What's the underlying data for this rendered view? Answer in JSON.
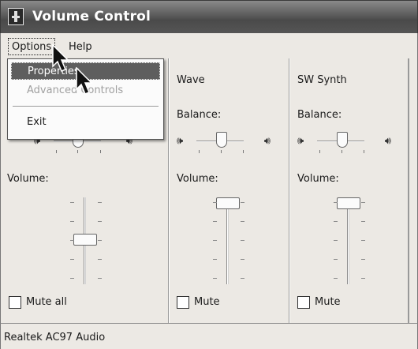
{
  "window": {
    "title": "Volume Control"
  },
  "menubar": {
    "options": "Options",
    "help": "Help"
  },
  "options_menu": {
    "properties": "Properties",
    "advanced_controls": "Advanced Controls",
    "exit": "Exit"
  },
  "columns": [
    {
      "title": "",
      "volume_label": "Volume:",
      "mute_label": "Mute all",
      "volume_level": 0.45,
      "muted": false
    },
    {
      "title": "Wave",
      "balance_label": "Balance:",
      "volume_label": "Volume:",
      "mute_label": "Mute",
      "volume_level": 0.95,
      "balance_level": 0.5,
      "muted": false
    },
    {
      "title": "SW Synth",
      "balance_label": "Balance:",
      "volume_label": "Volume:",
      "mute_label": "Mute",
      "volume_level": 0.95,
      "balance_level": 0.5,
      "muted": false
    }
  ],
  "master_balance_level": 0.5,
  "status": {
    "device": "Realtek AC97 Audio"
  },
  "icons": [
    "app-volume-icon",
    "speaker-left-icon",
    "speaker-right-icon",
    "pointer-cursor-icon"
  ]
}
